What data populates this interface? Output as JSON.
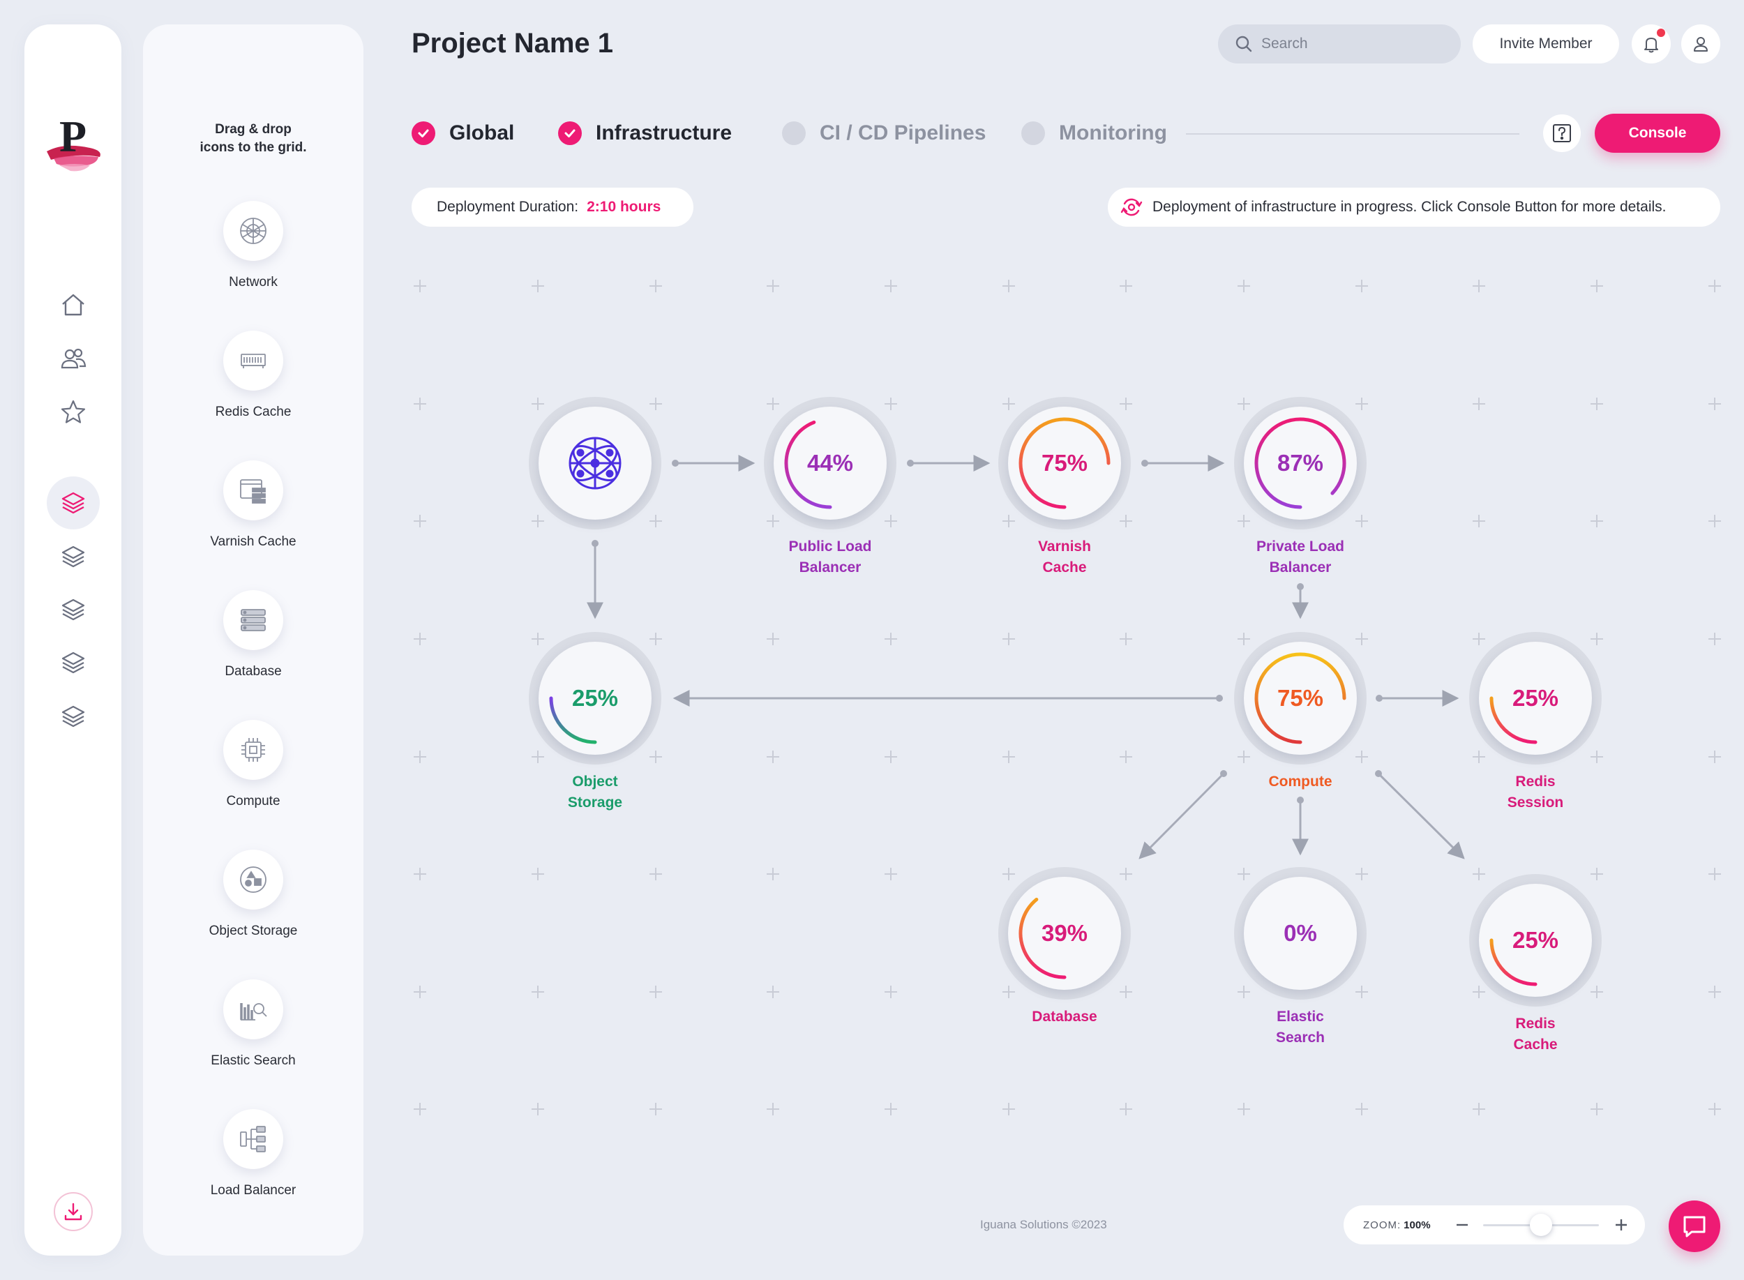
{
  "header": {
    "title": "Project Name 1",
    "search_placeholder": "Search",
    "invite_label": "Invite Member"
  },
  "palette": {
    "hint": "Drag & drop icons to the grid.",
    "items": [
      {
        "label": "Network",
        "icon": "network-icon"
      },
      {
        "label": "Redis Cache",
        "icon": "redis-cache-icon"
      },
      {
        "label": "Varnish Cache",
        "icon": "varnish-cache-icon"
      },
      {
        "label": "Database",
        "icon": "database-icon"
      },
      {
        "label": "Compute",
        "icon": "compute-icon"
      },
      {
        "label": "Object Storage",
        "icon": "object-storage-icon"
      },
      {
        "label": "Elastic Search",
        "icon": "elastic-search-icon"
      },
      {
        "label": "Load Balancer",
        "icon": "load-balancer-icon"
      }
    ]
  },
  "steps": [
    {
      "label": "Global",
      "done": true
    },
    {
      "label": "Infrastructure",
      "done": true
    },
    {
      "label": "CI / CD Pipelines",
      "done": false
    },
    {
      "label": "Monitoring",
      "done": false
    }
  ],
  "console_label": "Console",
  "deployment": {
    "duration_label": "Deployment Duration:",
    "duration_value": "2:10 hours",
    "status": "Deployment of infrastructure in progress. Click Console Button for more details."
  },
  "diagram": {
    "nodes": [
      {
        "id": "network",
        "label": "",
        "pct": null,
        "percent": null,
        "color": "#4b2fe0"
      },
      {
        "id": "public-lb",
        "label": "Public Load\nBalancer",
        "pct": "44%",
        "percent": 44,
        "color": "#9b2fb5",
        "grad": [
          "#ee1b74",
          "#9b3fd6"
        ]
      },
      {
        "id": "varnish",
        "label": "Varnish\nCache",
        "pct": "75%",
        "percent": 75,
        "color": "#d81b7a",
        "grad": [
          "#f4a01c",
          "#ee1b74"
        ]
      },
      {
        "id": "private-lb",
        "label": "Private Load\nBalancer",
        "pct": "87%",
        "percent": 87,
        "color": "#9b2fb5",
        "grad": [
          "#ee1b74",
          "#9b3fd6"
        ]
      },
      {
        "id": "object-storage",
        "label": "Object\nStorage",
        "pct": "25%",
        "percent": 25,
        "color": "#1a9c6a",
        "grad": [
          "#7b3fe4",
          "#22b26b"
        ]
      },
      {
        "id": "compute",
        "label": "Compute",
        "pct": "75%",
        "percent": 75,
        "color": "#ef5a22",
        "grad": [
          "#f7c21a",
          "#e0393b"
        ]
      },
      {
        "id": "redis-session",
        "label": "Redis\nSession",
        "pct": "25%",
        "percent": 25,
        "color": "#d81b7a",
        "grad": [
          "#f4a01c",
          "#ee1b74"
        ]
      },
      {
        "id": "database",
        "label": "Database",
        "pct": "39%",
        "percent": 39,
        "color": "#d81b7a",
        "grad": [
          "#f4a01c",
          "#ee1b74"
        ]
      },
      {
        "id": "elastic",
        "label": "Elastic\nSearch",
        "pct": "0%",
        "percent": 0,
        "color": "#9b2fb5",
        "grad": [
          "#ee1b74",
          "#9b3fd6"
        ]
      },
      {
        "id": "redis-cache",
        "label": "Redis\nCache",
        "pct": "25%",
        "percent": 25,
        "color": "#d81b7a",
        "grad": [
          "#f4a01c",
          "#ee1b74"
        ]
      }
    ]
  },
  "footer": {
    "copyright": "Iguana Solutions ©2023",
    "zoom_label": "ZOOM:",
    "zoom_value": "100%",
    "zoom_level": 0.5
  }
}
